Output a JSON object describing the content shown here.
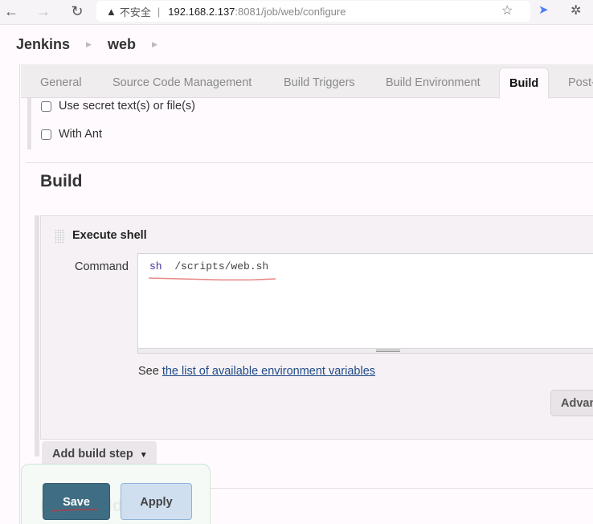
{
  "browser": {
    "back_icon": "←",
    "forward_icon": "→",
    "reload_icon": "↻",
    "warning_icon": "▲",
    "security_label": "不安全",
    "separator": "|",
    "url_host": "192.168.2.137",
    "url_path": ":8081/job/web/configure",
    "bookmark_icon": "☆",
    "extension_icon": "➤",
    "puzzle_icon": "✲"
  },
  "breadcrumb": {
    "items": [
      "Jenkins",
      "web"
    ],
    "separator": "▶"
  },
  "tabs": [
    {
      "label": "General",
      "active": false
    },
    {
      "label": "Source Code Management",
      "active": false
    },
    {
      "label": "Build Triggers",
      "active": false
    },
    {
      "label": "Build Environment",
      "active": false
    },
    {
      "label": "Build",
      "active": true
    },
    {
      "label": "Post-",
      "active": false
    }
  ],
  "build_environment": {
    "options": [
      {
        "label": "Use secret text(s) or file(s)",
        "checked": false
      },
      {
        "label": "With Ant",
        "checked": false
      }
    ]
  },
  "build": {
    "section_title": "Build",
    "step": {
      "title": "Execute shell",
      "command_label": "Command",
      "command_keyword": "sh",
      "command_rest": "  /scripts/web.sh",
      "see_prefix": "See ",
      "env_link": "the list of available environment variables",
      "advanced_label": "Advanced..."
    },
    "add_step_label": "Add build step",
    "add_step_caret": "▼"
  },
  "post_build": {
    "section_title": "Post-build Actions"
  },
  "actions": {
    "save_label": "Save",
    "apply_label": "Apply"
  },
  "colors": {
    "save_bg": "#3f6e84",
    "apply_bg": "#cfdff0",
    "link": "#204a87",
    "annotation_red": "#e06a6a"
  }
}
